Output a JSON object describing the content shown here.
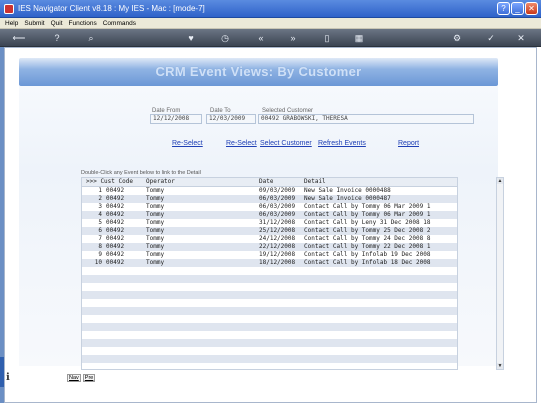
{
  "window": {
    "title": "IES Navigator Client v8.18 : My IES - Mac :       [mode-7]"
  },
  "menu": {
    "items": [
      "Help",
      "Submit",
      "Quit",
      "Functions",
      "Commands"
    ]
  },
  "toolbar": {
    "icons": [
      "back-arrow-icon",
      "help-icon",
      "search-icon",
      "heart-icon",
      "clock-icon",
      "rewind-icon",
      "forward-icon",
      "document-icon",
      "grid-icon",
      "gear-icon",
      "check-icon",
      "close-icon"
    ]
  },
  "page": {
    "title": "CRM Event Views: By Customer"
  },
  "filters": {
    "date_from_label": "Date From",
    "date_from": "12/12/2008",
    "date_to_label": "Date To",
    "date_to": "12/03/2009",
    "customer_label": "Selected Customer",
    "customer": "00492 GRABOWSKI, THERESA"
  },
  "actions": {
    "reselect_1": "Re-Select",
    "reselect_2": "Re-Select",
    "select_customer": "Select Customer",
    "refresh_events": "Refresh Events",
    "report": "Report"
  },
  "grid": {
    "hint": "Double-Click any Event below to link to the Detail",
    "headers": [
      ">>> Cust Code",
      "Operator",
      "Date",
      "Detail"
    ],
    "rows": [
      {
        "n": "1",
        "code": "00492",
        "operator": "Tommy",
        "date": "09/03/2009",
        "detail": "New Sale Invoice 0000488"
      },
      {
        "n": "2",
        "code": "00492",
        "operator": "Tommy",
        "date": "06/03/2009",
        "detail": "New Sale Invoice 0000487"
      },
      {
        "n": "3",
        "code": "00492",
        "operator": "Tommy",
        "date": "06/03/2009",
        "detail": "Contact Call by Tommy 06 Mar 2009 1"
      },
      {
        "n": "4",
        "code": "00492",
        "operator": "Tommy",
        "date": "06/03/2009",
        "detail": "Contact Call by Tommy 06 Mar 2009 1"
      },
      {
        "n": "5",
        "code": "00492",
        "operator": "Tommy",
        "date": "31/12/2008",
        "detail": "Contact Call by Leny 31 Dec 2008 18"
      },
      {
        "n": "6",
        "code": "00492",
        "operator": "Tommy",
        "date": "25/12/2008",
        "detail": "Contact Call by Tommy 25 Dec 2008 2"
      },
      {
        "n": "7",
        "code": "00492",
        "operator": "Tommy",
        "date": "24/12/2008",
        "detail": "Contact Call by Tommy 24 Dec 2008 8"
      },
      {
        "n": "8",
        "code": "00492",
        "operator": "Tommy",
        "date": "22/12/2008",
        "detail": "Contact Call by Tommy 22 Dec 2008 1"
      },
      {
        "n": "9",
        "code": "00492",
        "operator": "Tommy",
        "date": "19/12/2008",
        "detail": "Contact Call by Infolab 19 Dec 2008"
      },
      {
        "n": "10",
        "code": "00492",
        "operator": "Tommy",
        "date": "18/12/2008",
        "detail": "Contact Call by Infolab 18 Dec 2008"
      }
    ]
  },
  "footer": {
    "nav_1": "Nav",
    "nav_2": "Pre"
  }
}
